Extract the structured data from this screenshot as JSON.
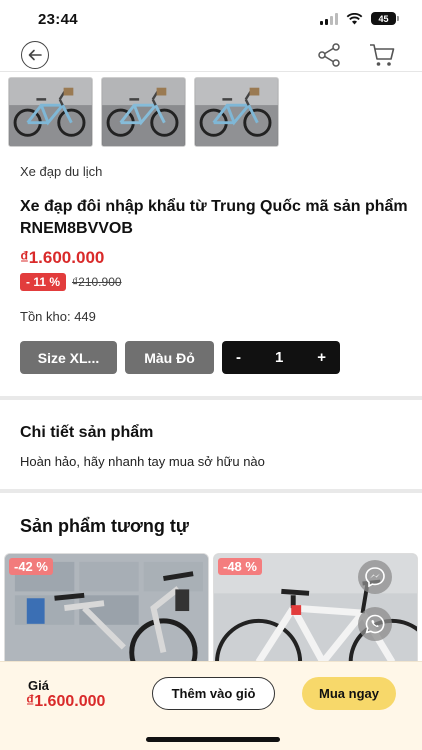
{
  "status_bar": {
    "time": "23:44",
    "battery": "45",
    "icons": [
      "signal-icon",
      "wifi-icon",
      "battery-icon"
    ]
  },
  "nav": {
    "icons": [
      "back-arrow-icon",
      "share-icon",
      "cart-icon"
    ]
  },
  "product": {
    "category": "Xe đạp du lịch",
    "title": "Xe đạp đôi nhập khẩu từ Trung Quốc mã sản phẩm RNEM8BVVOB",
    "price": "₫1.600.000",
    "discount": "- 11 %",
    "old_price": "₫210.900",
    "stock": "Tồn kho: 449",
    "thumbnail_count": 3
  },
  "options": {
    "size_label": "Size XL...",
    "color_label": "Màu Đỏ",
    "qty_minus": "-",
    "qty_value": "1",
    "qty_plus": "+"
  },
  "detail": {
    "title": "Chi tiết sản phẩm",
    "text": "Hoàn hảo, hãy nhanh tay mua sở hữu nào"
  },
  "similar": {
    "title": "Sản phẩm tương tự",
    "items": [
      {
        "badge": "-42 %"
      },
      {
        "badge": "-48 %"
      }
    ]
  },
  "bottom_bar": {
    "price_label": "Giá",
    "price": "₫1.600.000",
    "add_to_cart": "Thêm vào giỏ",
    "buy_now": "Mua ngay"
  },
  "colors": {
    "price_red": "#d92a2a",
    "badge_red": "#e23c3c",
    "buy_yellow": "#f7d86a",
    "bottom_bg": "#fff7e8",
    "variant_gray": "#707070"
  }
}
